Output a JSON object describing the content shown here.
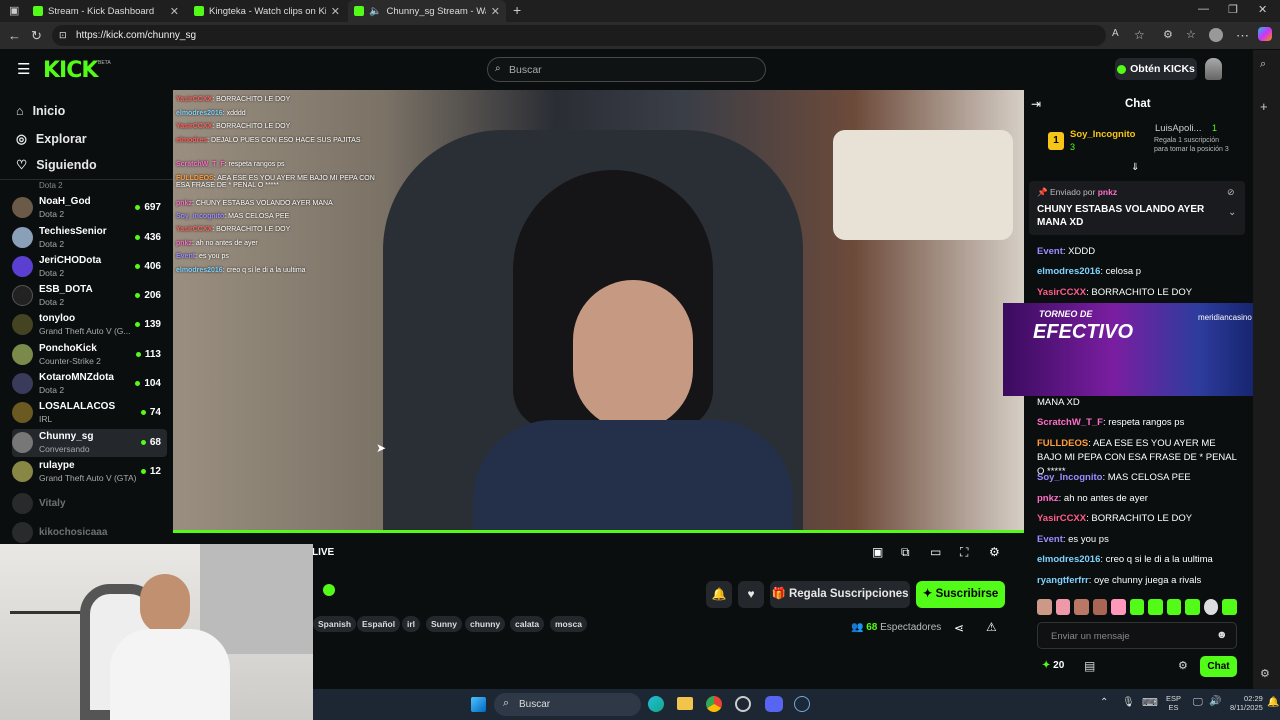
{
  "browser": {
    "tabs": [
      {
        "title": "Stream - Kick Dashboard"
      },
      {
        "title": "Kingteka - Watch clips on Kick"
      },
      {
        "title": "Chunny_sg Stream - Watch l"
      }
    ],
    "url": "https://kick.com/chunny_sg"
  },
  "header": {
    "logo": "KICK",
    "beta": "BETA",
    "search_placeholder": "Buscar",
    "kicks_button": "Obtén KICKs"
  },
  "sidebar": {
    "nav": [
      {
        "label": "Inicio",
        "icon": "home-icon"
      },
      {
        "label": "Explorar",
        "icon": "compass-icon"
      },
      {
        "label": "Siguiendo",
        "icon": "heart-icon"
      }
    ],
    "partial_top": "Dota 2",
    "channels": [
      {
        "name": "NoaH_God",
        "category": "Dota 2",
        "viewers": "697",
        "color": "#6b5a48"
      },
      {
        "name": "TechiesSenior",
        "category": "Dota 2",
        "viewers": "436",
        "color": "#8aa0b8"
      },
      {
        "name": "JeriCHODota",
        "category": "Dota 2",
        "viewers": "406",
        "color": "#5a3fd1"
      },
      {
        "name": "ESB_DOTA",
        "category": "Dota 2",
        "viewers": "206",
        "color": "#222"
      },
      {
        "name": "tonyloo",
        "category": "Grand Theft Auto V (G...",
        "viewers": "139",
        "color": "#442"
      },
      {
        "name": "PonchoKick",
        "category": "Counter-Strike 2",
        "viewers": "113",
        "color": "#7a8a4a"
      },
      {
        "name": "KotaroMNZdota",
        "category": "Dota 2",
        "viewers": "104",
        "color": "#3a3a5a"
      },
      {
        "name": "LOSALALACOS",
        "category": "IRL",
        "viewers": "74",
        "color": "#6a5a22"
      },
      {
        "name": "Chunny_sg",
        "category": "Conversando",
        "viewers": "68",
        "color": "#777"
      },
      {
        "name": "rulaype",
        "category": "Grand Theft Auto V (GTA)",
        "viewers": "12",
        "color": "#884"
      }
    ],
    "offline": [
      {
        "name": "Vitaly"
      },
      {
        "name": "kikochosicaaa"
      }
    ]
  },
  "overlay_chat": [
    {
      "user": "YasirCCXX",
      "text": ": BORRACHITO LE DOY"
    },
    {
      "user": "elmodres2016",
      "text": ": xdddd"
    },
    {
      "user": "YasirCCXX",
      "text": ": BORRACHITO LE DOY"
    },
    {
      "user": "elmodres",
      "text": ": DEJALO PUES CON ESO HACE SUS PAJITAS"
    },
    {
      "user": "ScratchW_T_F",
      "text": ": respeta rangos ps"
    },
    {
      "user": "FULLDEOS",
      "text": ": AEA ESE ES YOU AYER ME BAJO MI PEPA CON ESA FRASE DE * PENAL O *****"
    },
    {
      "user": "pnkz",
      "text": ": CHUNY ESTABAS VOLANDO AYER MANA"
    },
    {
      "user": "Soy_Incognito",
      "text": ": MAS CELOSA PEE"
    },
    {
      "user": "YasirCCXX",
      "text": ": BORRACHITO LE DOY"
    },
    {
      "user": "pnkz",
      "text": ": ah no antes de ayer"
    },
    {
      "user": "Event",
      "text": ": es you ps"
    },
    {
      "user": "elmodres2016",
      "text": ": creo q si le di a la uultima"
    }
  ],
  "player": {
    "live_label": "LIVE"
  },
  "stream_info": {
    "tags": [
      "Spanish",
      "Español",
      "irl",
      "Sunny",
      "chunny",
      "calata",
      "mosca"
    ],
    "gift_button": "Regala Suscripciones",
    "subscribe_button": "Suscribirse",
    "viewers": "68",
    "viewers_label": "Espectadores"
  },
  "chat": {
    "title": "Chat",
    "leaderboard": [
      {
        "name": "Soy_Incognito",
        "count": "3"
      },
      {
        "name": "LuisApoli...",
        "count": "1"
      }
    ],
    "leaderboard_note": "Regala 1 suscripción para tomar la posición 3",
    "pinned_by_label": "Enviado por",
    "pinned_user": "pnkz",
    "pinned_text": "CHUNY ESTABAS VOLANDO AYER MANA XD",
    "messages": [
      {
        "user": "Event",
        "text": ": XDDD",
        "color": "#9b8cff"
      },
      {
        "user": "elmodres2016",
        "text": ": celosa p",
        "color": "#7fd3ff"
      },
      {
        "user": "YasirCCXX",
        "text": ": BORRACHITO LE DOY",
        "color": "#ff5e8a"
      }
    ],
    "messages2": [
      {
        "user": "",
        "text": "MANA XD",
        "color": "#fff"
      },
      {
        "user": "ScratchW_T_F",
        "text": ": respeta rangos ps",
        "color": "#ff6ec7"
      },
      {
        "user": "FULLDEOS",
        "text": ": AEA ESE ES YOU AYER ME BAJO MI PEPA CON ESA FRASE DE * PENAL O *****",
        "color": "#ff9d3c"
      },
      {
        "user": "Soy_Incognito",
        "text": ": MAS CELOSA PEE",
        "color": "#9b8cff"
      },
      {
        "user": "pnkz",
        "text": ": ah no antes de ayer",
        "color": "#ff6ec7"
      },
      {
        "user": "YasirCCXX",
        "text": ": BORRACHITO LE DOY",
        "color": "#ff5e8a"
      },
      {
        "user": "Event",
        "text": ": es you ps",
        "color": "#9b8cff"
      },
      {
        "user": "elmodres2016",
        "text": ": creo q si le di a la uultima",
        "color": "#7fd3ff"
      },
      {
        "user": "ryangtferfrr",
        "text": ": oye chunny juega a rivals",
        "color": "#7fd3ff"
      }
    ],
    "input_placeholder": "Enviar un mensaje",
    "kicks_count": "20",
    "send_button": "Chat"
  },
  "ad": {
    "title": "TORNEO DE",
    "title2": "EFECTIVO",
    "brand": "meridiancasino"
  },
  "taskbar": {
    "search": "Buscar",
    "lang1": "ESP",
    "lang2": "ES",
    "time": "02:29",
    "date": "8/11/2025"
  }
}
